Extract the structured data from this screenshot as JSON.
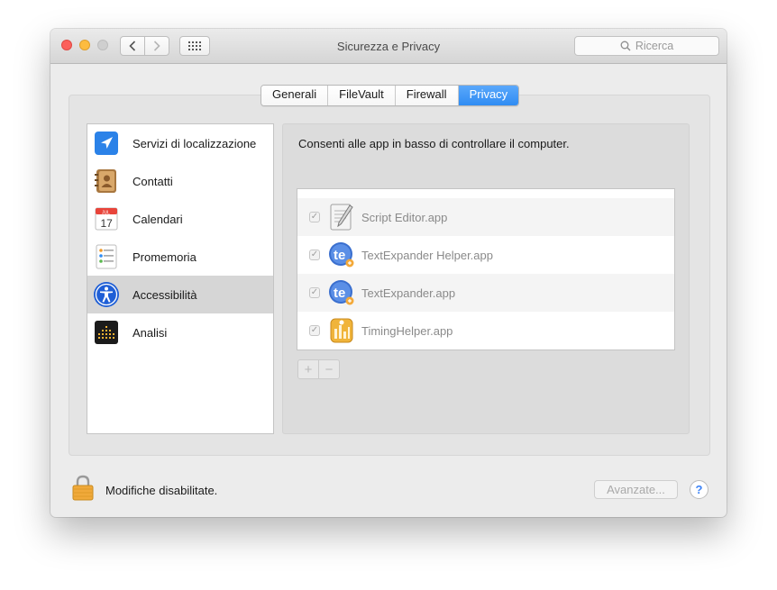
{
  "window": {
    "title": "Sicurezza e Privacy",
    "search_placeholder": "Ricerca"
  },
  "tabs": [
    {
      "label": "Generali",
      "active": false
    },
    {
      "label": "FileVault",
      "active": false
    },
    {
      "label": "Firewall",
      "active": false
    },
    {
      "label": "Privacy",
      "active": true
    }
  ],
  "sidebar": {
    "items": [
      {
        "label": "Servizi di localizzazione",
        "icon": "location-arrow-icon",
        "selected": false
      },
      {
        "label": "Contatti",
        "icon": "contacts-book-icon",
        "selected": false
      },
      {
        "label": "Calendari",
        "icon": "calendar-icon",
        "selected": false
      },
      {
        "label": "Promemoria",
        "icon": "reminders-icon",
        "selected": false
      },
      {
        "label": "Accessibilità",
        "icon": "accessibility-icon",
        "selected": true
      },
      {
        "label": "Analisi",
        "icon": "analytics-icon",
        "selected": false
      }
    ],
    "calendar_month": "JUL",
    "calendar_day": "17"
  },
  "panel": {
    "description": "Consenti alle app in basso di controllare il computer.",
    "apps": [
      {
        "name": "Script Editor.app",
        "checked": true,
        "icon": "script-editor-icon"
      },
      {
        "name": "TextExpander Helper.app",
        "checked": true,
        "icon": "textexpander-icon"
      },
      {
        "name": "TextExpander.app",
        "checked": true,
        "icon": "textexpander-icon"
      },
      {
        "name": "TimingHelper.app",
        "checked": true,
        "icon": "timing-helper-icon"
      }
    ],
    "add_label": "+",
    "remove_label": "−"
  },
  "footer": {
    "lock_label": "Modifiche disabilitate.",
    "advanced_label": "Avanzate...",
    "help_label": "?"
  },
  "colors": {
    "accent": "#3b8ff6",
    "close": "#fc605b",
    "minimize": "#fdbc40"
  }
}
